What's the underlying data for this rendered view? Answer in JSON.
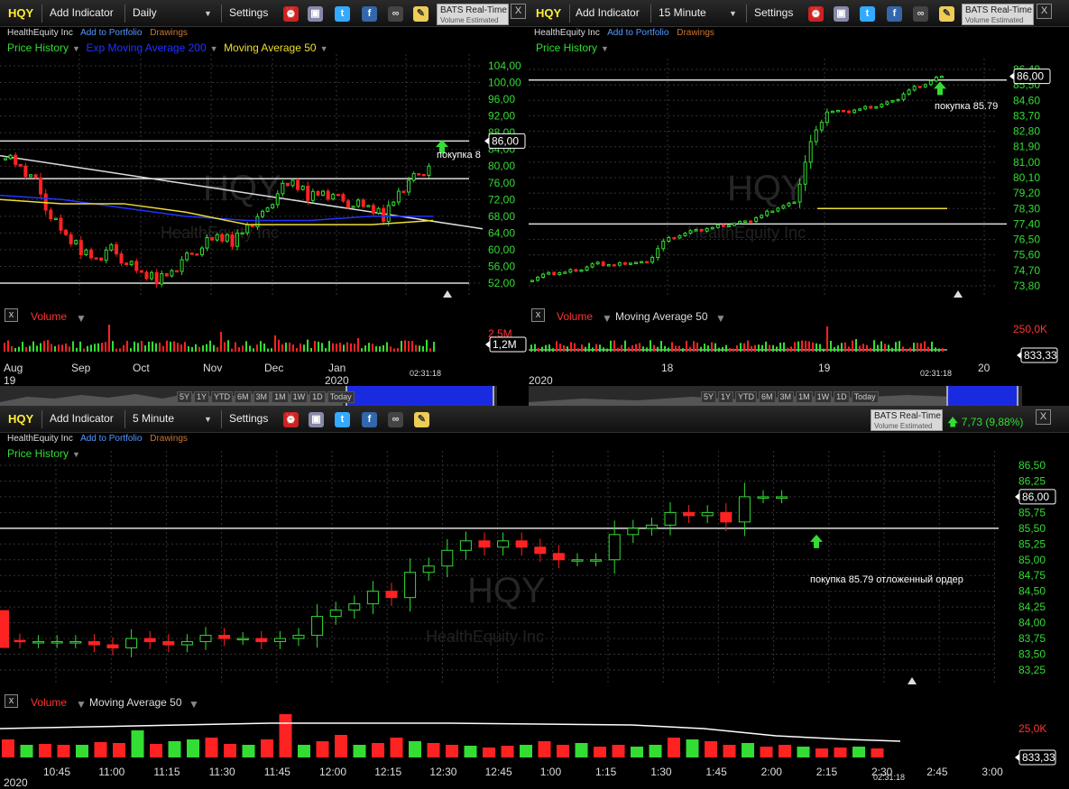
{
  "colors": {
    "up": "#33dd33",
    "down": "#ff2222",
    "bg": "#000000",
    "ema": "#2233ff",
    "ma": "#eedd33"
  },
  "common": {
    "symbol": "HQY",
    "add_indicator": "Add Indicator",
    "settings": "Settings",
    "company": "HealthEquity Inc",
    "add_portfolio": "Add to Portfolio",
    "drawings": "Drawings",
    "price_history": "Price History",
    "volume": "Volume",
    "ma50": "Moving Average 50",
    "bats_title": "BATS Real-Time",
    "bats_sub": "Volume Estimated",
    "close": "X",
    "clock": "02:31:18",
    "watermark": "HQY",
    "watermark_sub": "HealthEquity Inc",
    "price_tag": "86,00",
    "ranges": [
      "5Y",
      "1Y",
      "YTD",
      "6M",
      "3M",
      "1M",
      "1W",
      "1D",
      "Today"
    ]
  },
  "panel1": {
    "interval": "Daily",
    "ema200": "Exp Moving Average 200",
    "yticks": [
      "104,00",
      "100,00",
      "96,00",
      "92,00",
      "88,00",
      "84,00",
      "80,00",
      "76,00",
      "72,00",
      "68,00",
      "64,00",
      "60,00",
      "56,00",
      "52,00"
    ],
    "xticks": [
      "Aug",
      "Sep",
      "Oct",
      "Nov",
      "Dec",
      "Jan"
    ],
    "x_year_left": "19",
    "x_year_jan": "2020",
    "vol_max": "2,5M",
    "vol_tag": "1,2M",
    "annotation": "покупка 8"
  },
  "panel2": {
    "interval": "15 Minute",
    "yticks": [
      "86,40",
      "85,50",
      "84,60",
      "83,70",
      "82,80",
      "81,90",
      "81,00",
      "80,10",
      "79,20",
      "78,30",
      "77,40",
      "76,50",
      "75,60",
      "74,70",
      "73,80"
    ],
    "xticks": [
      "18",
      "19",
      "20"
    ],
    "x_year_left": "2020",
    "vol_max": "250,0K",
    "vol_tag": "833,33",
    "annotation": "покупка 85.79"
  },
  "panel3": {
    "interval": "5 Minute",
    "change": "7,73 (9,88%)",
    "yticks": [
      "86,50",
      "86,25",
      "86,00",
      "85,75",
      "85,50",
      "85,25",
      "85,00",
      "84,75",
      "84,50",
      "84,25",
      "84,00",
      "83,75",
      "83,50",
      "83,25"
    ],
    "xticks": [
      "10:45",
      "11:00",
      "11:15",
      "11:30",
      "11:45",
      "12:00",
      "12:15",
      "12:30",
      "12:45",
      "1:00",
      "1:15",
      "1:30",
      "1:45",
      "2:00",
      "2:15",
      "2:30",
      "2:45",
      "3:00"
    ],
    "x_year_left": "2020",
    "vol_max": "25,0K",
    "vol_tag": "833,33",
    "annotation": "покупка 85.79 отложенный ордер"
  },
  "chart_data": [
    {
      "type": "candlestick",
      "interval": "Daily",
      "x": [
        "Aug 2019",
        "Sep",
        "Oct",
        "Nov",
        "Dec",
        "Jan 2020"
      ],
      "ylim": [
        50,
        106
      ],
      "series": [
        {
          "name": "Price History",
          "approx_closes": [
            83,
            80,
            76,
            68,
            63,
            60,
            58,
            60,
            57,
            54,
            53,
            55,
            58,
            61,
            63,
            62,
            66,
            68,
            74,
            76,
            73,
            74,
            72,
            71,
            70,
            68,
            74,
            77,
            80
          ]
        },
        {
          "name": "Exp Moving Average 200",
          "approx_values": [
            73,
            72,
            70,
            68,
            67,
            67,
            68,
            68
          ]
        },
        {
          "name": "Moving Average 50",
          "approx_values": [
            72,
            71,
            71,
            69,
            66,
            66,
            66,
            67
          ]
        }
      ],
      "levels": [
        86,
        77,
        52
      ]
    },
    {
      "type": "candlestick",
      "interval": "15 Minute",
      "x": [
        "18",
        "19",
        "20"
      ],
      "ylim": [
        73.3,
        86.8
      ],
      "series": [
        {
          "name": "Price History",
          "approx_closes": [
            74.2,
            74.5,
            74.6,
            74.8,
            75.1,
            75.0,
            75.2,
            75.1,
            76.4,
            76.8,
            77.0,
            77.2,
            77.4,
            77.5,
            77.9,
            78.4,
            78.6,
            82.2,
            84.0,
            83.9,
            84.1,
            84.3,
            84.5,
            85.2,
            85.6,
            86.0
          ]
        }
      ],
      "levels": [
        85.78,
        77.4,
        78.3
      ]
    },
    {
      "type": "candlestick",
      "interval": "5 Minute",
      "x": [
        "10:45",
        "11:00",
        "11:15",
        "11:30",
        "11:45",
        "12:00",
        "12:15",
        "12:30",
        "12:45",
        "1:00",
        "1:15",
        "1:30",
        "1:45",
        "2:00",
        "2:15",
        "2:30",
        "2:45",
        "3:00"
      ],
      "ylim": [
        83.1,
        86.6
      ],
      "series": [
        {
          "name": "Price History",
          "approx_closes": [
            83.7,
            83.7,
            83.7,
            83.7,
            83.65,
            83.6,
            83.75,
            83.7,
            83.65,
            83.7,
            83.8,
            83.75,
            83.75,
            83.7,
            83.75,
            83.8,
            84.1,
            84.2,
            84.3,
            84.5,
            84.4,
            84.8,
            84.9,
            85.15,
            85.3,
            85.2,
            85.3,
            85.2,
            85.1,
            85.0,
            85.0,
            85.0,
            85.4,
            85.5,
            85.55,
            85.75,
            85.7,
            85.75,
            85.6,
            86.0,
            86.0,
            86.0
          ]
        }
      ],
      "levels": [
        85.5
      ]
    }
  ]
}
